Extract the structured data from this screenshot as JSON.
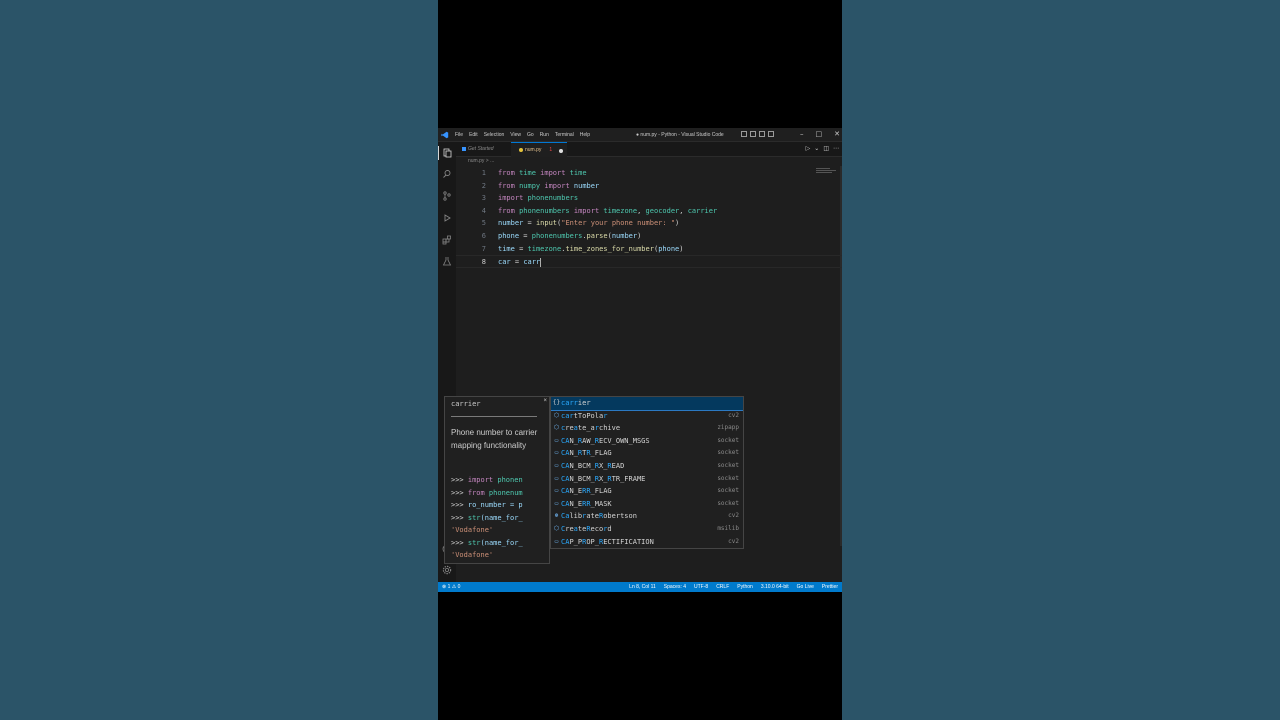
{
  "window": {
    "title": "● num.py - Python - Visual Studio Code",
    "menu": [
      "File",
      "Edit",
      "Selection",
      "View",
      "Go",
      "Run",
      "Terminal",
      "Help"
    ],
    "controls": {
      "minimize": "–",
      "maximize": "□",
      "close": "✕"
    }
  },
  "tabs": [
    {
      "label": "Get Started"
    },
    {
      "label": "num.py",
      "problems": "1"
    }
  ],
  "breadcrumb": "num.py > ...",
  "editor": {
    "current_line": 8,
    "lines": [
      {
        "n": "1",
        "text": "from time import time"
      },
      {
        "n": "2",
        "text": "from numpy import number"
      },
      {
        "n": "3",
        "text": "import phonenumbers"
      },
      {
        "n": "4",
        "text": "from phonenumbers import timezone, geocoder, carrier"
      },
      {
        "n": "5",
        "text": "number = input(\"Enter your phone number: \")"
      },
      {
        "n": "6",
        "text": "phone = phonenumbers.parse(number)"
      },
      {
        "n": "7",
        "text": "time = timezone.time_zones_for_number(phone)"
      },
      {
        "n": "8",
        "text": "car = carr"
      }
    ]
  },
  "suggest_details": {
    "title": "carrier",
    "close": "×",
    "description": "Phone number to carrier mapping functionality",
    "examples": [
      ">>> import phonen",
      ">>> from phonenum",
      ">>> ro_number = p",
      ">>> str(name_for_",
      "'Vodafone'",
      ">>> str(name_for_",
      "'Vodafone'"
    ]
  },
  "suggestions": [
    {
      "icon": "module-icon",
      "glyph": "{}",
      "label": "carrier",
      "source": "",
      "selected": true
    },
    {
      "icon": "function-icon",
      "glyph": "⬡",
      "label": "cartToPolar",
      "source": "cv2"
    },
    {
      "icon": "function-icon",
      "glyph": "⬡",
      "label": "create_archive",
      "source": "zipapp"
    },
    {
      "icon": "constant-icon",
      "glyph": "▭",
      "label": "CAN_RAW_RECV_OWN_MSGS",
      "source": "socket"
    },
    {
      "icon": "constant-icon",
      "glyph": "▭",
      "label": "CAN_RTR_FLAG",
      "source": "socket"
    },
    {
      "icon": "constant-icon",
      "glyph": "▭",
      "label": "CAN_BCM_RX_READ",
      "source": "socket"
    },
    {
      "icon": "constant-icon",
      "glyph": "▭",
      "label": "CAN_BCM_RX_RTR_FRAME",
      "source": "socket"
    },
    {
      "icon": "constant-icon",
      "glyph": "▭",
      "label": "CAN_ERR_FLAG",
      "source": "socket"
    },
    {
      "icon": "constant-icon",
      "glyph": "▭",
      "label": "CAN_ERR_MASK",
      "source": "socket"
    },
    {
      "icon": "class-icon",
      "glyph": "⊛",
      "label": "CalibrateRobertson",
      "source": "cv2"
    },
    {
      "icon": "function-icon",
      "glyph": "⬡",
      "label": "CreateRecord",
      "source": "msilib"
    },
    {
      "icon": "constant-icon",
      "glyph": "▭",
      "label": "CAP_PROP_RECTIFICATION",
      "source": "cv2"
    }
  ],
  "status": {
    "problems": "⊗ 1 ⚠ 0",
    "items": [
      "Ln 8, Col 11",
      "Spaces: 4",
      "UTF-8",
      "CRLF",
      "Python",
      "3.10.0 64-bit",
      "Go Live",
      "Prettier"
    ]
  },
  "colors": {
    "accent": "#007acc",
    "background": "#2b5468",
    "editor": "#1e1e1e"
  }
}
